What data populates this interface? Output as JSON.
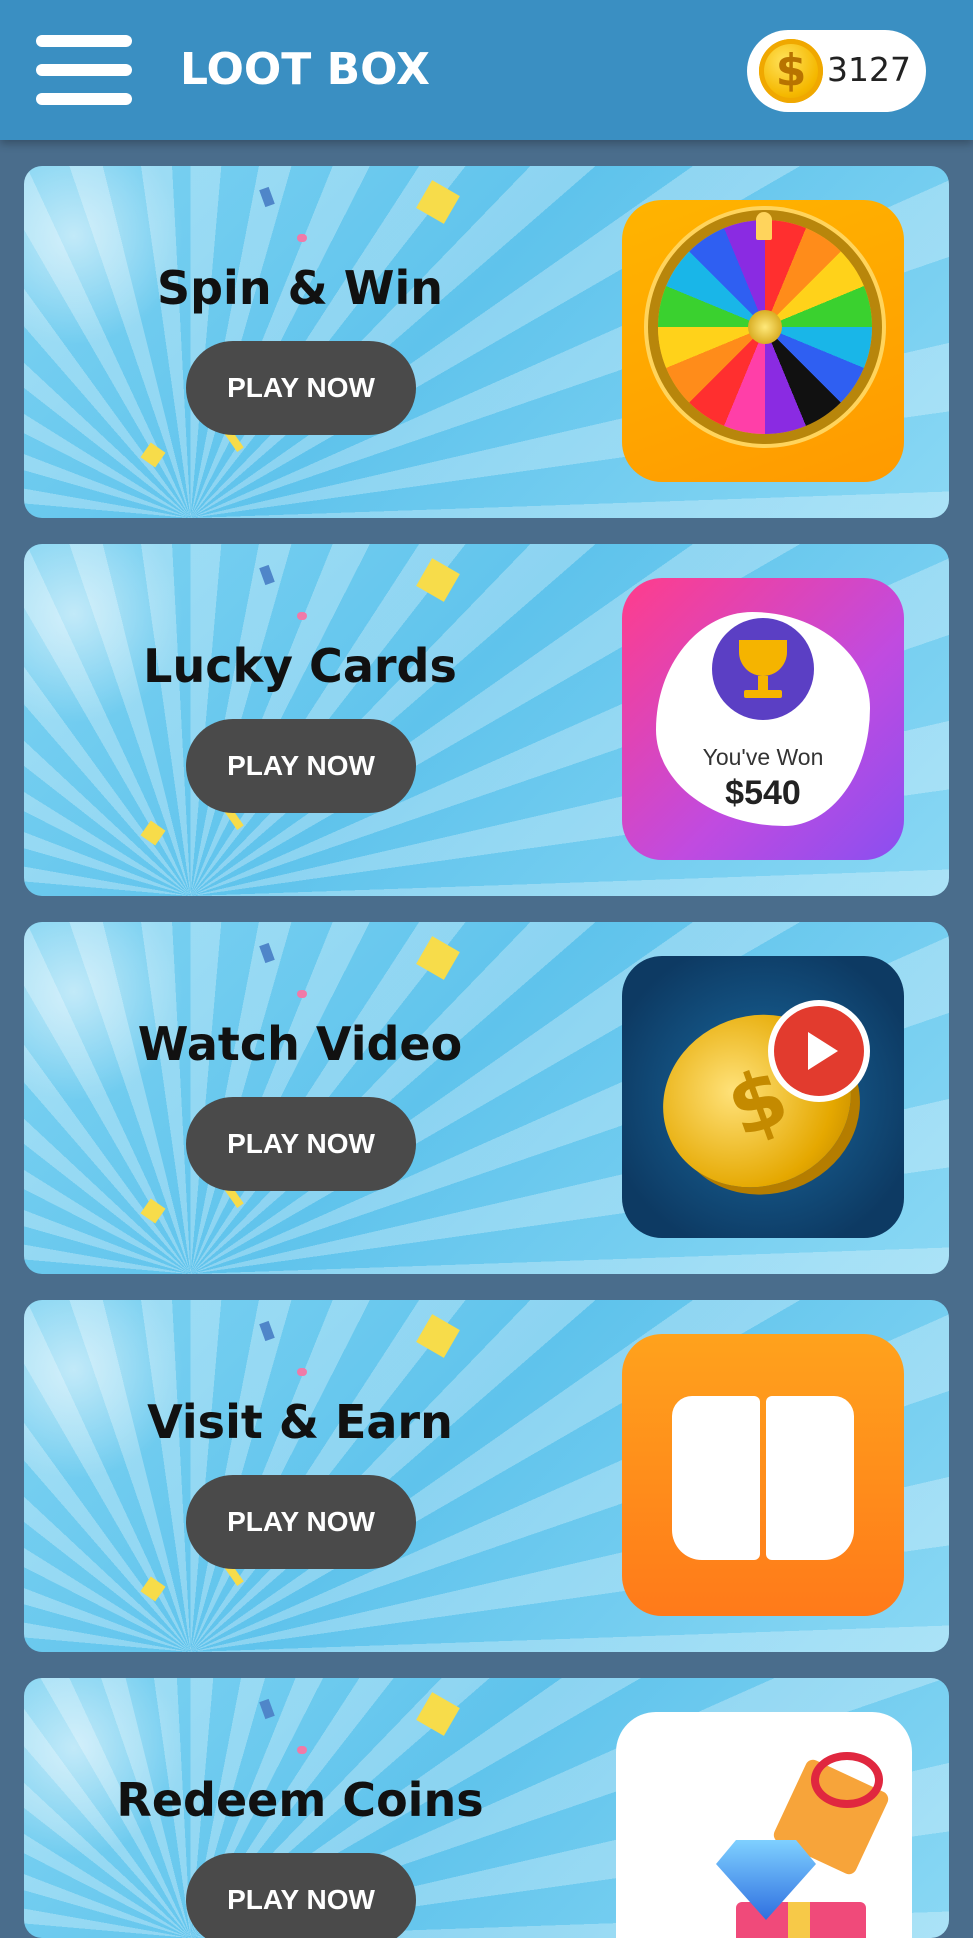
{
  "header": {
    "title": "LOOT BOX",
    "coin_balance": "3127",
    "coin_symbol": "$"
  },
  "cards": [
    {
      "title": "Spin & Win",
      "button_label": "PLAY NOW",
      "icon": "spin-wheel-icon"
    },
    {
      "title": "Lucky Cards",
      "button_label": "PLAY NOW",
      "icon": "scratch-card-icon",
      "won_text": "You've Won",
      "won_amount": "$540"
    },
    {
      "title": "Watch Video",
      "button_label": "PLAY NOW",
      "icon": "video-coin-icon"
    },
    {
      "title": "Visit & Earn",
      "button_label": "PLAY NOW",
      "icon": "open-book-icon"
    },
    {
      "title": "Redeem Coins",
      "button_label": "PLAY NOW",
      "icon": "gift-gem-icon"
    }
  ],
  "colors": {
    "appbar": "#3a8fc2",
    "background": "#4a6d8c",
    "button": "#4a4a4a",
    "card": "#6fcbef"
  }
}
